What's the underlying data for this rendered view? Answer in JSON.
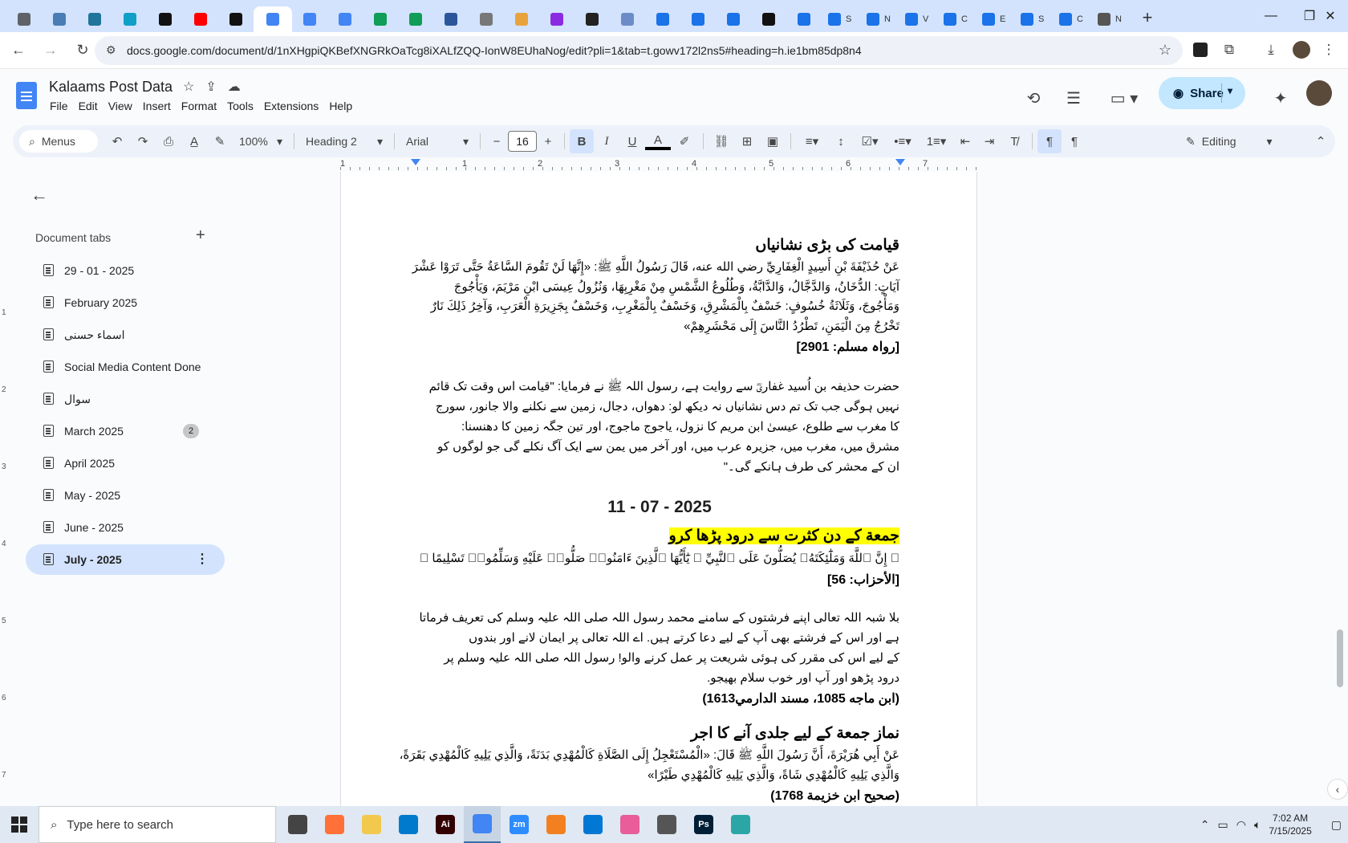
{
  "browser": {
    "tabs": [
      {
        "icon": "globe-icon",
        "color": "#5f6368",
        "label": ""
      },
      {
        "icon": "app-icon",
        "color": "#4a7db5",
        "label": ""
      },
      {
        "icon": "wordpress-icon",
        "color": "#21759b",
        "label": ""
      },
      {
        "icon": "app-icon",
        "color": "#0fa0c8",
        "label": ""
      },
      {
        "icon": "openai-icon",
        "color": "#111111",
        "label": ""
      },
      {
        "icon": "youtube-icon",
        "color": "#ff0000",
        "label": ""
      },
      {
        "icon": "bolt-icon",
        "color": "#111111",
        "label": ""
      },
      {
        "icon": "docs-icon",
        "color": "#4285f4",
        "label": "",
        "active": true
      },
      {
        "icon": "docs-icon",
        "color": "#4285f4",
        "label": ""
      },
      {
        "icon": "docs-icon",
        "color": "#4285f4",
        "label": ""
      },
      {
        "icon": "sheets-icon",
        "color": "#0f9d58",
        "label": ""
      },
      {
        "icon": "sheets-icon",
        "color": "#0f9d58",
        "label": ""
      },
      {
        "icon": "word-icon",
        "color": "#2b579a",
        "label": ""
      },
      {
        "icon": "globe-icon",
        "color": "#777777",
        "label": ""
      },
      {
        "icon": "app-icon",
        "color": "#e8a33d",
        "label": ""
      },
      {
        "icon": "code-icon",
        "color": "#8a2be2",
        "label": ""
      },
      {
        "icon": "app-icon",
        "color": "#222222",
        "label": ""
      },
      {
        "icon": "app-icon",
        "color": "#6b8cc7",
        "label": ""
      },
      {
        "icon": "forms-icon",
        "color": "#1a73e8",
        "label": ""
      },
      {
        "icon": "forms-icon",
        "color": "#1a73e8",
        "label": ""
      },
      {
        "icon": "forms-icon",
        "color": "#1a73e8",
        "label": ""
      },
      {
        "icon": "medium-icon",
        "color": "#111111",
        "label": ""
      },
      {
        "icon": "forms-icon",
        "color": "#1a73e8",
        "label": ""
      },
      {
        "icon": "forms-icon",
        "color": "#1a73e8",
        "label": "S"
      },
      {
        "icon": "forms-icon",
        "color": "#1a73e8",
        "label": "N"
      },
      {
        "icon": "forms-icon",
        "color": "#1a73e8",
        "label": "V"
      },
      {
        "icon": "forms-icon",
        "color": "#1a73e8",
        "label": "C"
      },
      {
        "icon": "forms-icon",
        "color": "#1a73e8",
        "label": "E"
      },
      {
        "icon": "forms-icon",
        "color": "#1a73e8",
        "label": "S"
      },
      {
        "icon": "forms-icon",
        "color": "#1a73e8",
        "label": "C"
      },
      {
        "icon": "globe-icon",
        "color": "#555555",
        "label": "N"
      }
    ],
    "new_tab": "+",
    "url": "docs.google.com/document/d/1nXHgpiQKBefXNGRkOaTcg8iXALfZQQ-IonW8EUhaNog/edit?pli=1&tab=t.gowv172l2ns5#heading=h.ie1bm85dp8n4"
  },
  "doc": {
    "title": "Kalaams Post Data",
    "menu": [
      "File",
      "Edit",
      "View",
      "Insert",
      "Format",
      "Tools",
      "Extensions",
      "Help"
    ],
    "share_label": "Share"
  },
  "format": {
    "menus_label": "Menus",
    "zoom": "100%",
    "style": "Heading 2",
    "font": "Arial",
    "size": "16",
    "mode": "Editing"
  },
  "ruler": {
    "h": [
      "1",
      "1",
      "2",
      "3",
      "4",
      "5",
      "6",
      "7"
    ],
    "v": [
      "1",
      "2",
      "3",
      "4",
      "5",
      "6",
      "7"
    ]
  },
  "sidebar": {
    "title": "Document tabs",
    "items": [
      {
        "label": "29 - 01 - 2025"
      },
      {
        "label": "February 2025"
      },
      {
        "label": "اسماء حسنی"
      },
      {
        "label": "Social Media Content Done"
      },
      {
        "label": "سوال"
      },
      {
        "label": "March 2025",
        "badge": "2"
      },
      {
        "label": "April 2025"
      },
      {
        "label": "May - 2025"
      },
      {
        "label": "June - 2025"
      },
      {
        "label": "July - 2025",
        "active": true
      }
    ]
  },
  "content": {
    "h1": "قیامت کی بڑی نشانیاں",
    "ar1": [
      "عَنْ حُذَيْفَةَ بْنِ أَسِيدٍ الْغِفَارِيِّ رضي الله عنه، قَالَ رَسُولُ اللَّهِ ﷺ: «إِنَّهَا لَنْ تَقُومَ السَّاعَةُ حَتَّى تَرَوْا عَشْرَ",
      "آيَاتٍ: الدُّخَانُ، وَالدَّجَّالُ، وَالدَّابَّةُ، وَطُلُوعُ الشَّمْسِ مِنْ مَغْرِبِهَا، وَنُزُولُ عِيسَى ابْنِ مَرْيَمَ، وَيَأْجُوجَ",
      "وَمَأْجُوجَ، وَثَلَاثَةُ خُسُوفٍ: خَسْفٌ بِالْمَشْرِقِ، وَخَسْفٌ بِالْمَغْرِبِ، وَخَسْفٌ بِجَزِيرَةِ الْعَرَبِ، وَآخِرُ ذَلِكَ نَارٌ",
      "تَخْرُجُ مِنَ الْيَمَنِ، تَطْرُدُ النَّاسَ إِلَى مَحْشَرِهِمْ»"
    ],
    "ref1": "[رواہ مسلم: 2901]",
    "ur1": [
      "حضرت حذیفہ بن اُسید غفاریؓ سے روایت ہے، رسول اللہ ﷺ نے فرمایا: \"قیامت اس وقت تک قائم",
      "نہیں ہوگی جب تک تم دس نشانیاں نہ دیکھ لو: دھواں، دجال، زمین سے نکلنے والا جانور، سورج",
      "کا مغرب سے طلوع، عیسیٰ ابن مریم کا نزول، یاجوج ماجوج، اور تین جگہ زمین کا دھنسنا:",
      "مشرق میں، مغرب میں، جزیرہ عرب میں، اور آخر میں یمن سے ایک آگ نکلے گی جو لوگوں کو",
      "ان کے محشر کی طرف ہانکے گی۔\""
    ],
    "date": "11 - 07 - 2025",
    "h2": "جمعة کے دن کثرت سے درود پڑھا کرو",
    "ar2": "﴿ إِنَّ ٱللَّهَ وَمَلَٰٓئِكَتَهُۥ يُصَلُّونَ عَلَى ٱلنَّبِيِّ ۚ يَٰٓأَيُّهَا ٱلَّذِينَ ءَامَنُوا۟ صَلُّوا۟ عَلَيْهِ وَسَلِّمُوا۟ تَسْلِيمًا ﴾",
    "ref2": "[الأحزاب: 56]",
    "ur2": [
      "بلا شبہ اللہ تعالی اپنے فرشتوں کے سامنے محمد رسول اللہ صلی اللہ علیہ وسلم کی تعریف فرماتا",
      "ہے اور اس کے فرشتے بھی آپ کے لیے دعا کرتے ہیں. اے اللہ تعالی پر ایمان لانے اور بندوں",
      "کے لیے اس کی مقرر کی ہوئی شریعت پر عمل کرنے والو! رسول اللہ صلی اللہ علیہ وسلم پر",
      "درود پڑھو اور آپ اور خوب سلام بھیجو."
    ],
    "ref3": "(ابن ماجه 1085، مسند الدارمي1613)",
    "h3": "نماز جمعة کے لیے جلدی آنے کا اجر",
    "ar3": [
      "عَنْ أَبِي هُرَيْرَةَ، أَنَّ رَسُولَ اللَّهِ ﷺ قَالَ: «الْمُسْتَعْجِلُ إِلَى الصَّلَاةِ كَالْمُهْدِي بَدَنَةً، وَالَّذِي يَلِيهِ كَالْمُهْدِي بَقَرَةً،",
      "وَالَّذِي يَلِيهِ كَالْمُهْدِي شَاةً، وَالَّذِي يَلِيهِ كَالْمُهْدِي طَيْرًا»"
    ],
    "ref4": "(صحيح ابن خزيمة 1768)"
  },
  "taskbar": {
    "search_placeholder": "Type here to search",
    "apps": [
      {
        "icon": "task-view-icon",
        "color": "#444444",
        "label": ""
      },
      {
        "icon": "firefox-icon",
        "color": "#ff7139",
        "label": ""
      },
      {
        "icon": "file-explorer-icon",
        "color": "#f2c94c",
        "label": ""
      },
      {
        "icon": "vscode-icon",
        "color": "#007acc",
        "label": ""
      },
      {
        "icon": "illustrator-icon",
        "color": "#330000",
        "label": "Ai"
      },
      {
        "icon": "chrome-icon",
        "color": "#4285f4",
        "label": "",
        "active": true
      },
      {
        "icon": "zoom-icon",
        "color": "#2d8cff",
        "label": "zm"
      },
      {
        "icon": "app-icon",
        "color": "#f38020",
        "label": ""
      },
      {
        "icon": "outlook-icon",
        "color": "#0078d4",
        "label": ""
      },
      {
        "icon": "app-icon",
        "color": "#e85d9a",
        "label": ""
      },
      {
        "icon": "pen-icon",
        "color": "#555555",
        "label": ""
      },
      {
        "icon": "photoshop-icon",
        "color": "#001e36",
        "label": "Ps"
      },
      {
        "icon": "app-icon",
        "color": "#2aa6a6",
        "label": ""
      }
    ],
    "time": "7:02 AM",
    "date": "7/15/2025"
  }
}
